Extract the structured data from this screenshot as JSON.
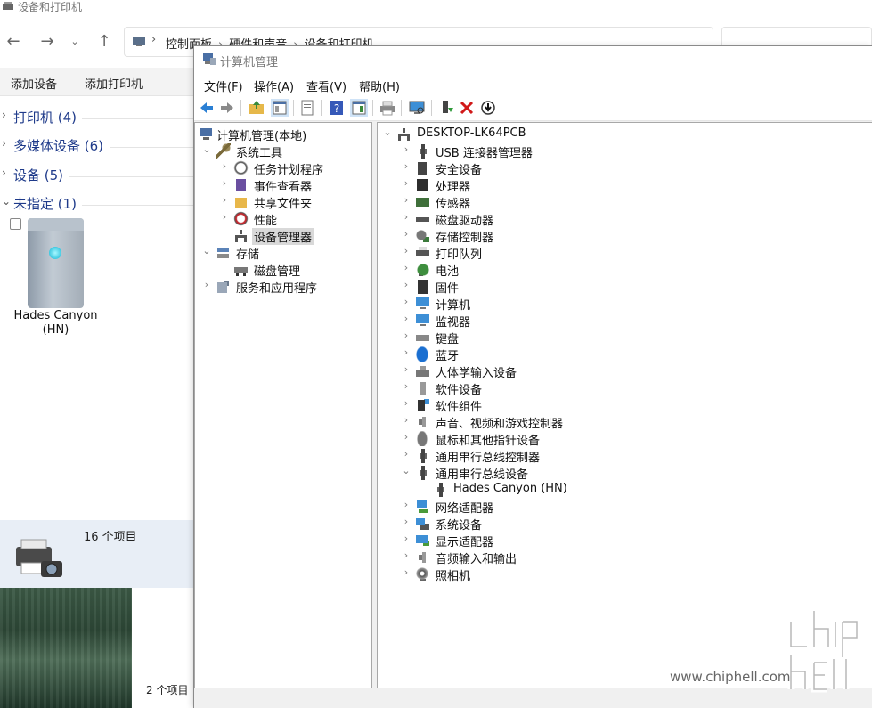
{
  "back_window": {
    "title": "设备和打印机",
    "breadcrumb": [
      "控制面板",
      "硬件和声音",
      "设备和打印机"
    ],
    "toolbar": {
      "add_device": "添加设备",
      "add_printer": "添加打印机"
    },
    "groups": [
      {
        "label": "打印机 (4)",
        "expanded": false
      },
      {
        "label": "多媒体设备 (6)",
        "expanded": false
      },
      {
        "label": "设备 (5)",
        "expanded": false
      },
      {
        "label": "未指定 (1)",
        "expanded": true
      }
    ],
    "device": {
      "name_line1": "Hades Canyon",
      "name_line2": "(HN)"
    },
    "details": {
      "count": "16 个项目"
    },
    "status": {
      "count": "2 个项目"
    }
  },
  "front_window": {
    "title": "计算机管理",
    "menu": [
      "文件(F)",
      "操作(A)",
      "查看(V)",
      "帮助(H)"
    ],
    "tree": {
      "root": "计算机管理(本地)",
      "system_tools": "系统工具",
      "task_scheduler": "任务计划程序",
      "event_viewer": "事件查看器",
      "shared_folders": "共享文件夹",
      "performance": "性能",
      "device_manager": "设备管理器",
      "storage": "存储",
      "disk_management": "磁盘管理",
      "services": "服务和应用程序"
    },
    "devices": {
      "computer_name": "DESKTOP-LK64PCB",
      "categories": [
        "USB 连接器管理器",
        "安全设备",
        "处理器",
        "传感器",
        "磁盘驱动器",
        "存储控制器",
        "打印队列",
        "电池",
        "固件",
        "计算机",
        "监视器",
        "键盘",
        "蓝牙",
        "人体学输入设备",
        "软件设备",
        "软件组件",
        "声音、视频和游戏控制器",
        "鼠标和其他指针设备",
        "通用串行总线控制器",
        "通用串行总线设备",
        "网络适配器",
        "系统设备",
        "显示适配器",
        "音频输入和输出",
        "照相机"
      ],
      "expanded_child": "Hades Canyon (HN)"
    }
  },
  "watermark": {
    "url": "www.chiphell.com"
  }
}
